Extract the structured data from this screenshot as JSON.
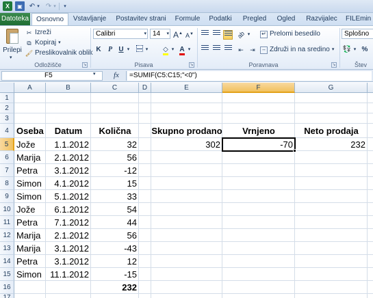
{
  "ribbon": {
    "tabs": [
      "Datoteka",
      "Osnovno",
      "Vstavljanje",
      "Postavitev strani",
      "Formule",
      "Podatki",
      "Pregled",
      "Ogled",
      "Razvijalec",
      "FILEmin"
    ],
    "active_tab": "Osnovno",
    "clipboard": {
      "paste": "Prilepi",
      "cut": "Izreži",
      "copy": "Kopiraj",
      "format_painter": "Preslikovalnik oblik",
      "group_label": "Odložišče"
    },
    "font": {
      "name": "Calibri",
      "size": "14",
      "grow": "A",
      "shrink": "A",
      "bold": "K",
      "italic": "P",
      "underline": "U",
      "font_color_letter": "A",
      "group_label": "Pisava"
    },
    "alignment": {
      "wrap_text": "Prelomi besedilo",
      "merge_center": "Združi in na sredino",
      "group_label": "Poravnava"
    },
    "number": {
      "format": "Splošno",
      "group_label": "Štev"
    }
  },
  "formula_bar": {
    "name_box": "F5",
    "fx": "fx",
    "formula": "=SUMIF(C5:C15;\"<0\")"
  },
  "sheet": {
    "columns": [
      "A",
      "B",
      "C",
      "D",
      "E",
      "F",
      "G"
    ],
    "rows": [
      "1",
      "2",
      "3",
      "4",
      "5",
      "6",
      "7",
      "8",
      "9",
      "10",
      "11",
      "12",
      "13",
      "14",
      "15",
      "16",
      "17"
    ],
    "active_cell": "F5",
    "headers": {
      "a4": "Oseba",
      "b4": "Datum",
      "c4": "Količna",
      "e4": "Skupno prodano",
      "f4": "Vrnjeno",
      "g4": "Neto prodaja"
    },
    "data": [
      {
        "oseba": "Jože",
        "datum": "1.1.2012",
        "kolicina": "32"
      },
      {
        "oseba": "Marija",
        "datum": "2.1.2012",
        "kolicina": "56"
      },
      {
        "oseba": "Petra",
        "datum": "3.1.2012",
        "kolicina": "-12"
      },
      {
        "oseba": "Simon",
        "datum": "4.1.2012",
        "kolicina": "15"
      },
      {
        "oseba": "Simon",
        "datum": "5.1.2012",
        "kolicina": "33"
      },
      {
        "oseba": "Jože",
        "datum": "6.1.2012",
        "kolicina": "54"
      },
      {
        "oseba": "Petra",
        "datum": "7.1.2012",
        "kolicina": "44"
      },
      {
        "oseba": "Marija",
        "datum": "2.1.2012",
        "kolicina": "56"
      },
      {
        "oseba": "Marija",
        "datum": "3.1.2012",
        "kolicina": "-43"
      },
      {
        "oseba": "Petra",
        "datum": "3.1.2012",
        "kolicina": "12"
      },
      {
        "oseba": "Simon",
        "datum": "11.1.2012",
        "kolicina": "-15"
      }
    ],
    "total_c16": "232",
    "summary": {
      "skupno_prodano": "302",
      "vrnjeno": "-70",
      "neto_prodaja": "232"
    }
  }
}
